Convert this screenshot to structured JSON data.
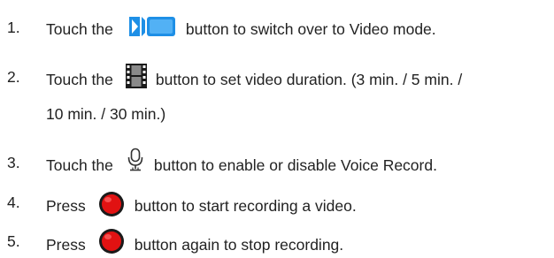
{
  "steps": [
    {
      "number": "1.",
      "before": "Touch the",
      "icon": "video-mode-icon",
      "after": "button to switch over to Video mode."
    },
    {
      "number": "2.",
      "before": "Touch the",
      "icon": "film-strip-icon",
      "after": "button to set video duration. (3 min. / 5 min. /",
      "continuation": "10 min. / 30 min.)"
    },
    {
      "number": "3.",
      "before": "Touch the",
      "icon": "microphone-icon",
      "after": "button to enable or disable Voice Record."
    },
    {
      "number": "4.",
      "before": "Press",
      "icon": "record-button-icon",
      "after": "button to start recording a video."
    },
    {
      "number": "5.",
      "before": "Press",
      "icon": "record-button-icon",
      "after": "button again to stop recording."
    }
  ],
  "colors": {
    "text": "#222222",
    "video_icon_blue": "#1e8fe6",
    "record_red": "#e11212"
  }
}
